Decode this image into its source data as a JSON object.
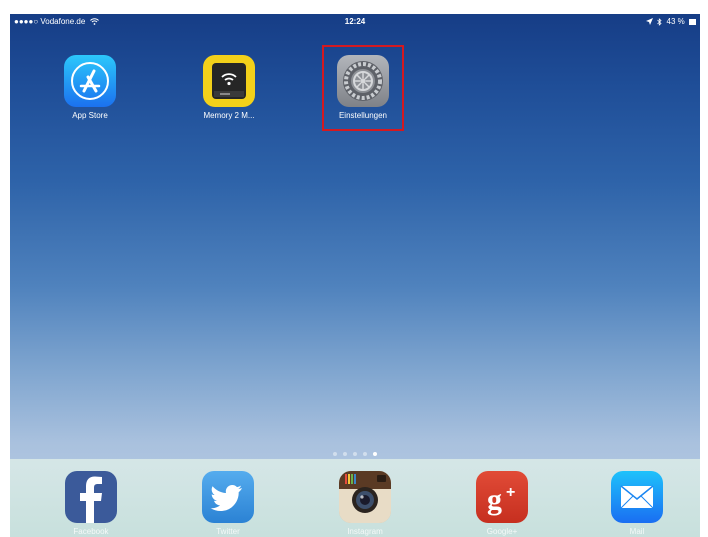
{
  "status_bar": {
    "carrier": "●●●●○ Vodafone.de",
    "time": "12:24",
    "battery": "43 %"
  },
  "home_apps": [
    {
      "label": "App Store",
      "icon": "app-store-icon"
    },
    {
      "label": "Memory 2 M...",
      "icon": "memory-drive-icon"
    },
    {
      "label": "Einstellungen",
      "icon": "settings-gear-icon"
    }
  ],
  "page_indicator": {
    "count": 5,
    "active_index": 4
  },
  "dock_apps": [
    {
      "label": "Facebook",
      "icon": "facebook-icon"
    },
    {
      "label": "Twitter",
      "icon": "twitter-icon"
    },
    {
      "label": "Instagram",
      "icon": "instagram-icon"
    },
    {
      "label": "Google+",
      "icon": "google-plus-icon"
    },
    {
      "label": "Mail",
      "icon": "mail-icon"
    }
  ],
  "colors": {
    "highlight": "#d41920",
    "facebook": "#3b5a9a",
    "google_plus": "#d13e2b",
    "app_store": "#1b8ff5"
  }
}
